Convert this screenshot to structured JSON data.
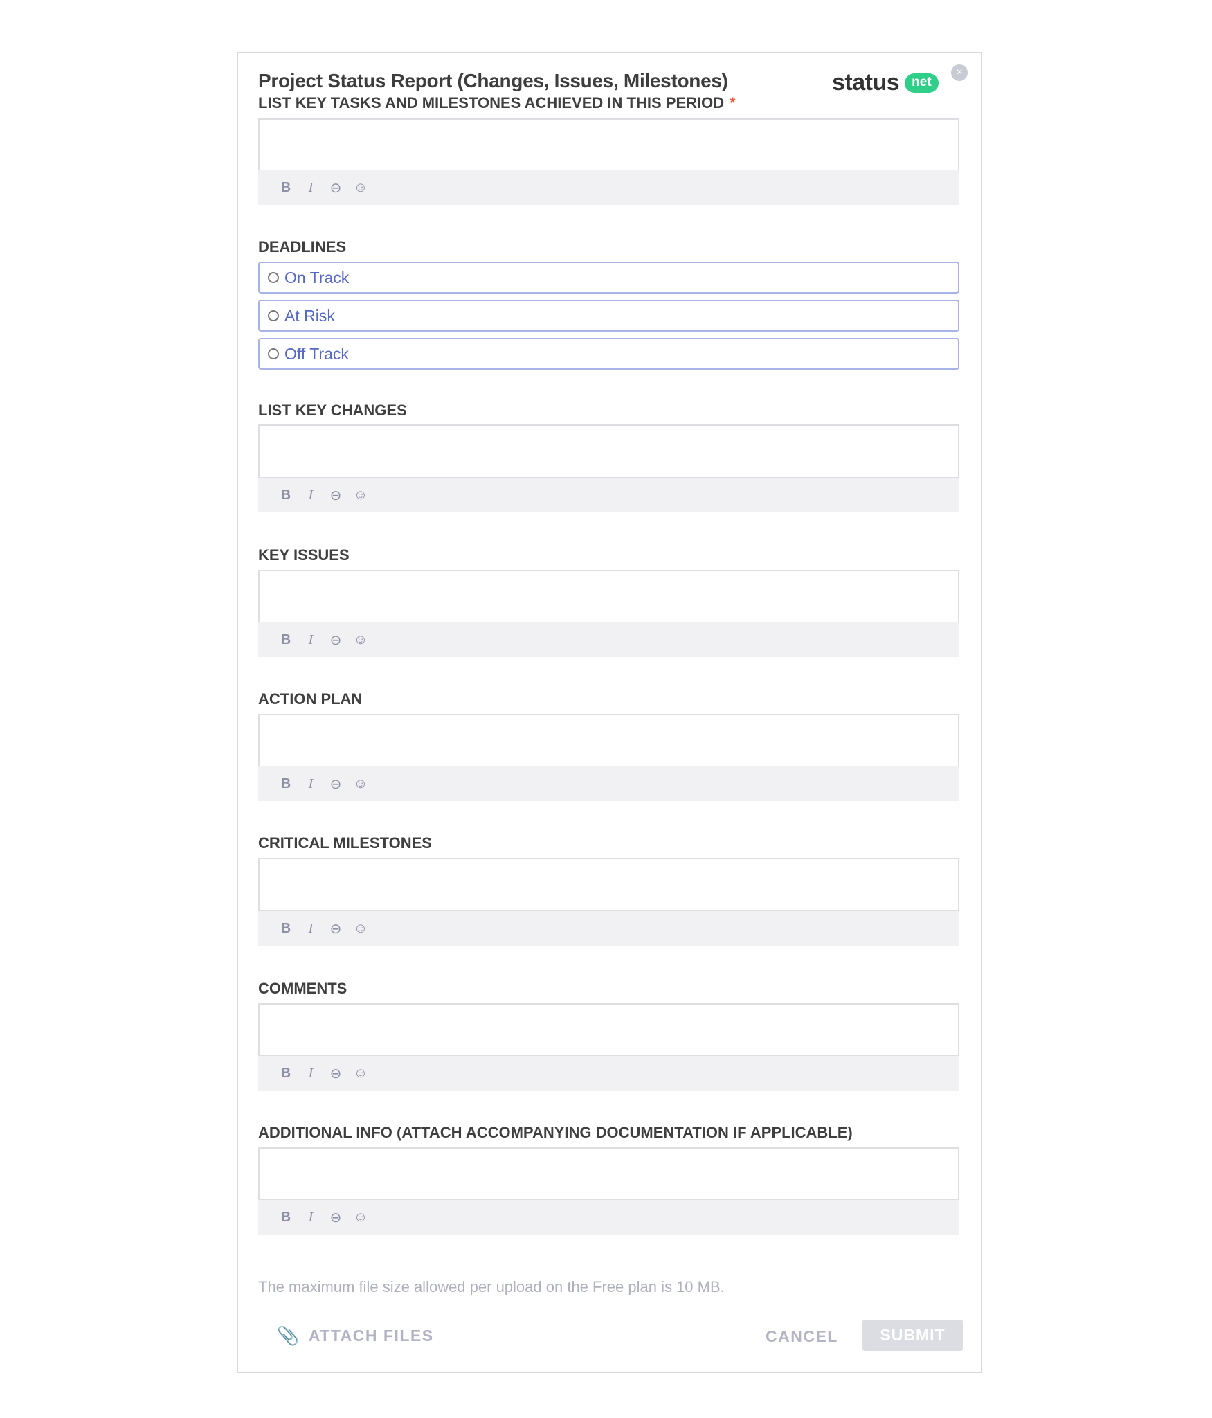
{
  "form": {
    "title": "Project Status Report (Changes, Issues, Milestones)",
    "close_icon": "×",
    "logo": {
      "text": "status",
      "badge": "net",
      "badge_color": "#2fcf8a"
    },
    "required_mark": "*"
  },
  "toolbar": {
    "bold": "B",
    "italic": "I",
    "link": "⊖",
    "emoji": "☺"
  },
  "fields": [
    {
      "label": "LIST KEY TASKS AND MILESTONES ACHIEVED IN THIS PERIOD",
      "value": ""
    },
    {
      "label": "LIST KEY CHANGES",
      "value": ""
    },
    {
      "label": "KEY ISSUES",
      "value": ""
    },
    {
      "label": "ACTION PLAN",
      "value": ""
    },
    {
      "label": "CRITICAL MILESTONES",
      "value": ""
    },
    {
      "label": "COMMENTS",
      "value": ""
    },
    {
      "label": "ADDITIONAL INFO (ATTACH ACCOMPANYING DOCUMENTATION IF APPLICABLE)",
      "value": ""
    }
  ],
  "deadlines": {
    "label": "DEADLINES",
    "options": [
      {
        "label": "On Track",
        "selected": false
      },
      {
        "label": "At Risk",
        "selected": false
      },
      {
        "label": "Off Track",
        "selected": false
      }
    ]
  },
  "footer": {
    "file_note": "The maximum file size allowed per upload on the Free plan is 10 MB.",
    "attach_label": "ATTACH FILES",
    "cancel_label": "CANCEL",
    "submit_label": "SUBMIT"
  }
}
